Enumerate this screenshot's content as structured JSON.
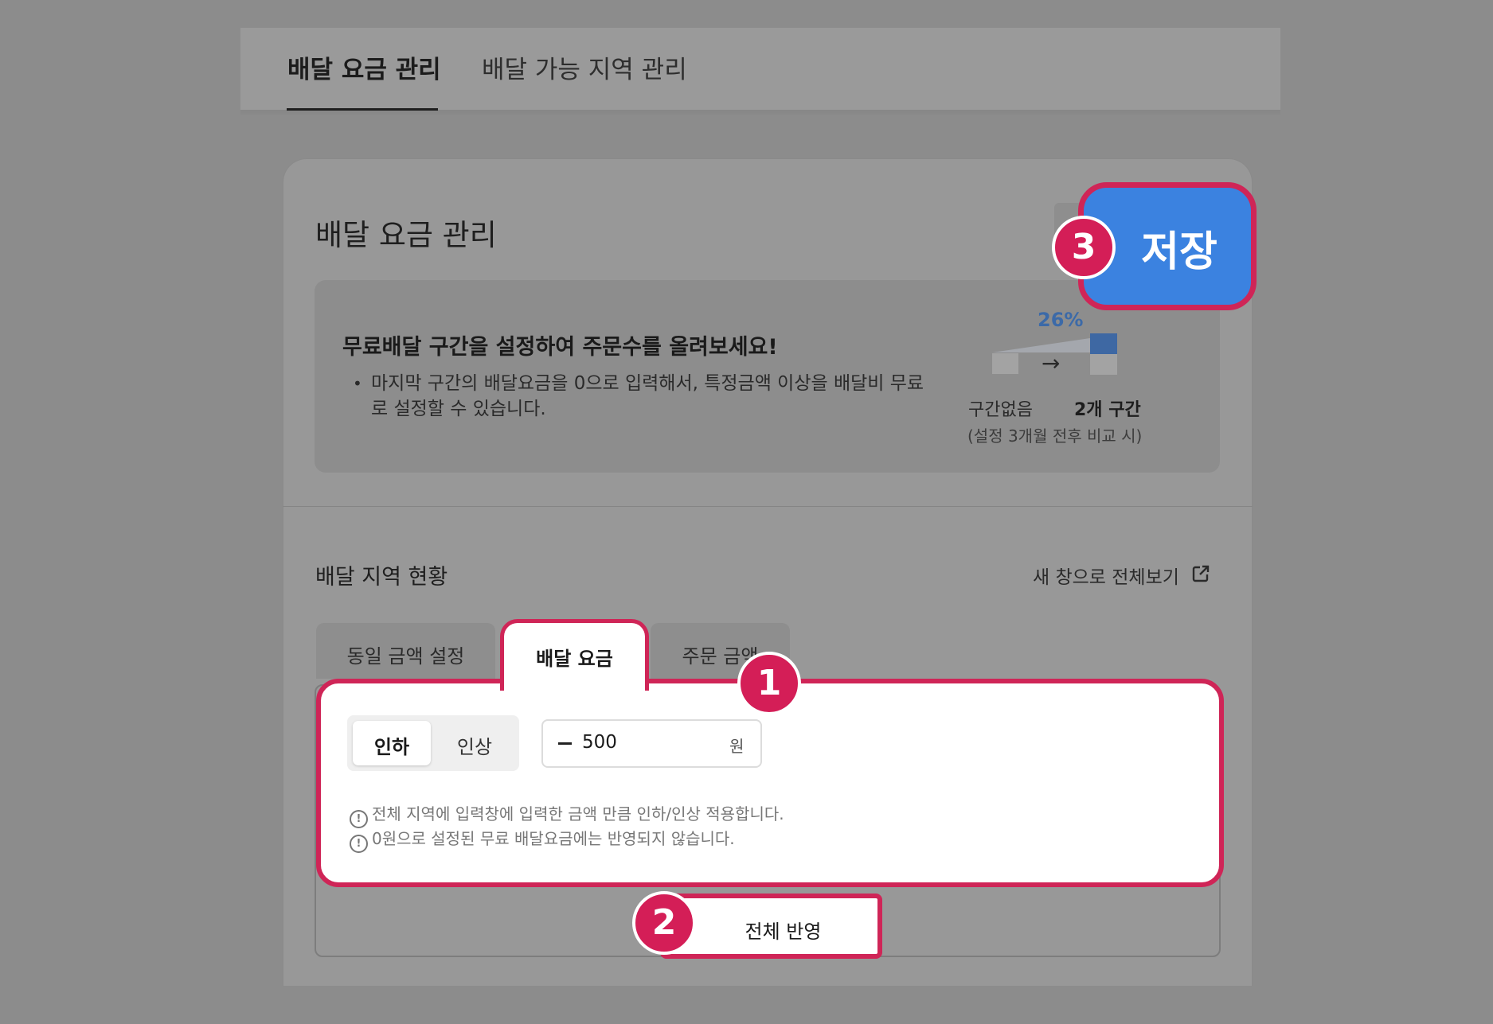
{
  "top_tabs": {
    "fee_management": "배달 요금 관리",
    "area_management": "배달 가능 지역 관리"
  },
  "card": {
    "title": "배달 요금 관리",
    "save_label": "저장"
  },
  "promo": {
    "title": "무료배달 구간을 설정하여 주문수를 올려보세요!",
    "bullet": "•",
    "description": "마지막 구간의 배달요금을 0으로 입력해서, 특정금액 이상을 배달비 무료로 설정할 수 있습니다.",
    "percent": "26%",
    "arrow": "→",
    "label_before": "구간없음",
    "label_after": "2개 구간",
    "label_note": "(설정 3개월 전후 비교 시)"
  },
  "section": {
    "title": "배달 지역 현황",
    "new_window_link": "새 창으로 전체보기"
  },
  "sub_tabs": {
    "same_amount": "동일 금액 설정",
    "delivery_fee": "배달 요금",
    "order_amount": "주문 금액"
  },
  "adjust": {
    "decrease": "인하",
    "increase": "인상",
    "amount_value": "500",
    "unit": "원",
    "note1": "전체 지역에 입력창에 입력한 금액 만큼 인하/인상 적용합니다.",
    "note2": "0원으로 설정된 무료 배달요금에는 반영되지 않습니다.",
    "apply_all": "전체 반영"
  },
  "badges": {
    "step1": "1",
    "step2": "2",
    "step3": "3",
    "notice_glyph": "!"
  },
  "colors": {
    "highlight": "#cf2557",
    "badge": "#d41e57",
    "save_blue": "#3b82e0",
    "percent_blue": "#3c6aa8"
  }
}
